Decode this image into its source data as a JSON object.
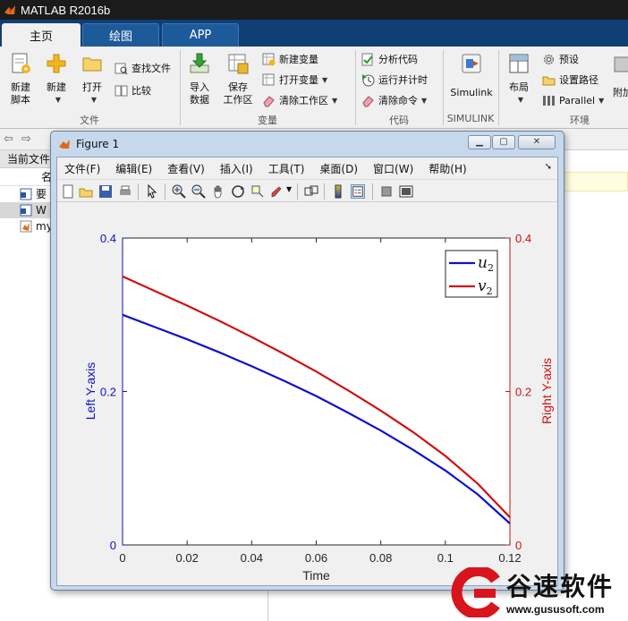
{
  "app": {
    "title": "MATLAB R2016b"
  },
  "tabs": [
    {
      "label": "主页"
    },
    {
      "label": "绘图"
    },
    {
      "label": "APP"
    }
  ],
  "ribbon": {
    "file": {
      "new_script": "新建\n脚本",
      "new": "新建",
      "open": "打开",
      "find_files": "查找文件",
      "compare": "比较",
      "section": "文件"
    },
    "variable": {
      "import_data": "导入\n数据",
      "save_workspace": "保存\n工作区",
      "new_variable": "新建变量",
      "open_variable": "打开变量",
      "clear_workspace": "清除工作区",
      "section": "变量"
    },
    "code": {
      "analyze": "分析代码",
      "run_and_time": "运行并计时",
      "clear_commands": "清除命令",
      "section": "代码"
    },
    "simulink": {
      "button": "Simulink",
      "section": "SIMULINK"
    },
    "environment": {
      "layout": "布局",
      "preferences": "预设",
      "set_path": "设置路径",
      "parallel": "Parallel",
      "addons": "附加",
      "section": "环境"
    }
  },
  "current_folder": {
    "label": "当前文件",
    "column_name": "名",
    "files": [
      {
        "name": "要",
        "icon": "word-doc-icon"
      },
      {
        "name": "W",
        "icon": "word-doc-icon"
      },
      {
        "name": "my",
        "icon": "matlab-file-icon"
      }
    ]
  },
  "figure": {
    "title": "Figure 1",
    "menu": [
      "文件(F)",
      "编辑(E)",
      "查看(V)",
      "插入(I)",
      "工具(T)",
      "桌面(D)",
      "窗口(W)",
      "帮助(H)"
    ]
  },
  "chart_data": {
    "type": "line",
    "xlabel": "Time",
    "ylabel_left": "Left Y-axis",
    "ylabel_right": "Right Y-axis",
    "xlim": [
      0,
      0.12
    ],
    "ylim_left": [
      0,
      0.4
    ],
    "ylim_right": [
      0,
      0.4
    ],
    "x_ticks": [
      "0",
      "0.02",
      "0.04",
      "0.06",
      "0.08",
      "0.1",
      "0.12"
    ],
    "y_ticks_left": [
      "0",
      "0.2",
      "0.4"
    ],
    "y_ticks_right": [
      "0",
      "0.2",
      "0.4"
    ],
    "left_axis_color": "#1010c8",
    "right_axis_color": "#d01010",
    "legend_position": "top-right",
    "series": [
      {
        "name": "u2",
        "legend_base": "u",
        "legend_sub": "2",
        "color": "#1010c8",
        "axis": "left",
        "x": [
          0,
          0.01,
          0.02,
          0.03,
          0.04,
          0.05,
          0.06,
          0.07,
          0.08,
          0.09,
          0.1,
          0.11,
          0.12
        ],
        "y": [
          0.3,
          0.284,
          0.268,
          0.251,
          0.233,
          0.214,
          0.194,
          0.172,
          0.149,
          0.124,
          0.097,
          0.066,
          0.028
        ]
      },
      {
        "name": "v2",
        "legend_base": "v",
        "legend_sub": "2",
        "color": "#d01010",
        "axis": "right",
        "x": [
          0,
          0.01,
          0.02,
          0.03,
          0.04,
          0.05,
          0.06,
          0.07,
          0.08,
          0.09,
          0.1,
          0.11,
          0.12
        ],
        "y": [
          0.35,
          0.331,
          0.312,
          0.292,
          0.271,
          0.249,
          0.226,
          0.201,
          0.175,
          0.147,
          0.116,
          0.08,
          0.036
        ]
      }
    ]
  },
  "watermark": {
    "text": "谷速软件",
    "url": "www.gususoft.com"
  }
}
